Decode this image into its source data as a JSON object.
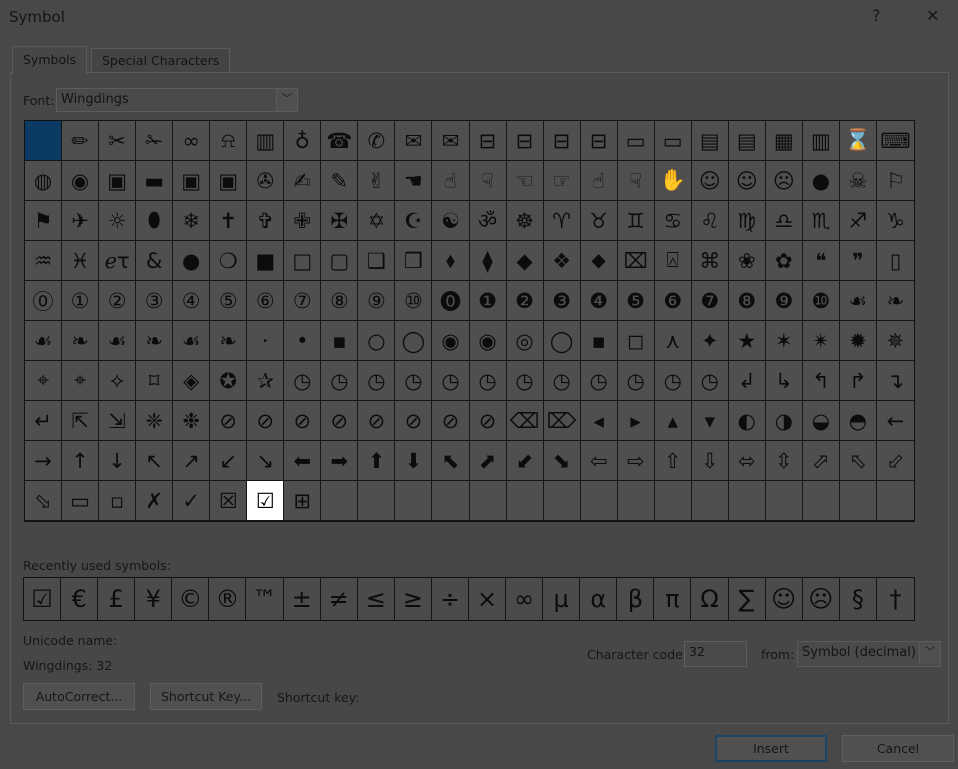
{
  "window": {
    "title": "Symbol",
    "help_label": "?",
    "close_label": "✕"
  },
  "tabs": [
    {
      "label": "Symbols",
      "active": true
    },
    {
      "label": "Special Characters",
      "active": false
    }
  ],
  "font": {
    "label": "Font:",
    "value": "Wingdings"
  },
  "grid": {
    "selected_index": 0,
    "hover_index": 222,
    "selected_color": "#0b3a63",
    "rows": [
      [
        " ",
        "✏",
        "✂",
        "✁",
        "∞",
        "⍾",
        "▥",
        "♁",
        "☎",
        "✆",
        "✉",
        "✉",
        "⊟",
        "⊟",
        "⊟",
        "⊟",
        "▭",
        "▭",
        "▤",
        "▤",
        "▦",
        "▥",
        "⌛",
        "⌨"
      ],
      [
        "◍",
        "◉",
        "▣",
        "▬",
        "▣",
        "▣",
        "✇",
        "✍",
        "✎",
        "✌",
        "☚",
        "☝",
        "☟",
        "☜",
        "☞",
        "☝",
        "☟",
        "✋",
        "☺",
        "☺",
        "☹",
        "●",
        "☠",
        "⚐"
      ],
      [
        "⚑",
        "✈",
        "☼",
        "⬮",
        "❄",
        "✝",
        "✞",
        "✙",
        "✠",
        "✡",
        "☪",
        "☯",
        "ॐ",
        "☸",
        "♈",
        "♉",
        "♊",
        "♋",
        "♌",
        "♍",
        "♎",
        "♏",
        "♐",
        "♑"
      ],
      [
        "♒",
        "♓",
        "ℯτ",
        "&",
        "●",
        "❍",
        "■",
        "□",
        "▢",
        "❑",
        "❒",
        "⬧",
        "⧫",
        "◆",
        "❖",
        "⬥",
        "⌧",
        "⍓",
        "⌘",
        "❀",
        "✿",
        "❝",
        "❞",
        "▯"
      ],
      [
        "⓪",
        "①",
        "②",
        "③",
        "④",
        "⑤",
        "⑥",
        "⑦",
        "⑧",
        "⑨",
        "⑩",
        "⓿",
        "❶",
        "❷",
        "❸",
        "❹",
        "❺",
        "❻",
        "❼",
        "❽",
        "❾",
        "❿",
        "☙",
        "❧"
      ],
      [
        "☙",
        "❧",
        "☙",
        "❧",
        "☙",
        "❧",
        "·",
        "•",
        "▪",
        "○",
        "◯",
        "◉",
        "◉",
        "◎",
        "◯",
        "▪",
        "◻",
        "⋏",
        "✦",
        "★",
        "✶",
        "✴",
        "✹",
        "✵"
      ],
      [
        "⌖",
        "⌖",
        "⟡",
        "⌑",
        "◈",
        "✪",
        "✰",
        "◷",
        "◷",
        "◷",
        "◷",
        "◷",
        "◷",
        "◷",
        "◷",
        "◷",
        "◷",
        "◷",
        "◷",
        "↲",
        "↳",
        "↰",
        "↱",
        "↴"
      ],
      [
        "↵",
        "⇱",
        "⇲",
        "❈",
        "❉",
        "⊘",
        "⊘",
        "⊘",
        "⊘",
        "⊘",
        "⊘",
        "⊘",
        "⊘",
        "⌫",
        "⌦",
        "◂",
        "▸",
        "▴",
        "▾",
        "◐",
        "◑",
        "◒",
        "◓",
        "←"
      ],
      [
        "→",
        "↑",
        "↓",
        "↖",
        "↗",
        "↙",
        "↘",
        "⬅",
        "➡",
        "⬆",
        "⬇",
        "⬉",
        "⬈",
        "⬋",
        "⬊",
        "⇦",
        "⇨",
        "⇧",
        "⇩",
        "⬄",
        "⇳",
        "⬀",
        "⬁",
        "⬃"
      ],
      [
        "⬂",
        "▭",
        "▫",
        "✗",
        "✓",
        "☒",
        "☑",
        "⊞"
      ]
    ]
  },
  "recent": {
    "label": "Recently used symbols:",
    "symbols": [
      "☑",
      "€",
      "£",
      "¥",
      "©",
      "®",
      "™",
      "±",
      "≠",
      "≤",
      "≥",
      "÷",
      "×",
      "∞",
      "µ",
      "α",
      "β",
      "π",
      "Ω",
      "∑",
      "☺",
      "☹",
      "§",
      "†"
    ]
  },
  "info": {
    "unicode_name_label": "Unicode name:",
    "font_code": "Wingdings: 32"
  },
  "buttons": {
    "autocorrect": "AutoCorrect...",
    "shortcut_key": "Shortcut Key...",
    "shortcut_key_label": "Shortcut key:",
    "insert": "Insert",
    "cancel": "Cancel"
  },
  "char_code": {
    "label": "Character code:",
    "value": "32",
    "from_label": "from:",
    "from_value": "Symbol (decimal)"
  }
}
